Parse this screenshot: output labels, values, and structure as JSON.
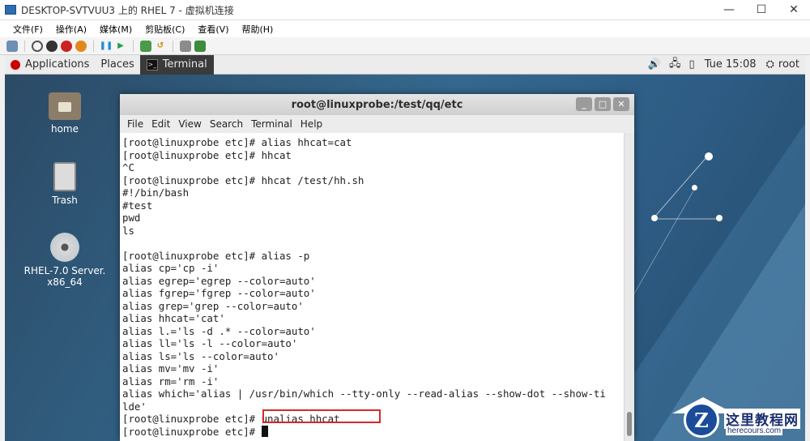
{
  "host_window": {
    "title": "DESKTOP-SVTVUU3 上的 RHEL 7 - 虚拟机连接",
    "controls": {
      "minimize": "—",
      "maximize": "☐",
      "close": "✕"
    },
    "menu": [
      "文件(F)",
      "操作(A)",
      "媒体(M)",
      "剪贴板(C)",
      "查看(V)",
      "帮助(H)"
    ],
    "toolbar_icons": [
      "ctrl-alt-del-icon",
      "start-icon",
      "turn-off-icon",
      "shutdown-icon",
      "save-icon",
      "pause-icon",
      "resume-icon",
      "checkpoint-icon",
      "revert-icon",
      "enhanced-session-icon",
      "share-icon"
    ]
  },
  "gnome_panel": {
    "applications": "Applications",
    "places": "Places",
    "task_label": "Terminal",
    "clock": "Tue 15:08",
    "user": "root"
  },
  "desktop": {
    "icons": [
      {
        "label": "home"
      },
      {
        "label": "Trash"
      },
      {
        "label_line1": "RHEL-7.0 Server.",
        "label_line2": "x86_64"
      }
    ]
  },
  "terminal": {
    "title": "root@linuxprobe:/test/qq/etc",
    "menu": [
      "File",
      "Edit",
      "View",
      "Search",
      "Terminal",
      "Help"
    ],
    "lines": [
      "[root@linuxprobe etc]# alias hhcat=cat",
      "[root@linuxprobe etc]# hhcat",
      "^C",
      "[root@linuxprobe etc]# hhcat /test/hh.sh",
      "#!/bin/bash",
      "#test",
      "pwd",
      "ls",
      "",
      "[root@linuxprobe etc]# alias -p",
      "alias cp='cp -i'",
      "alias egrep='egrep --color=auto'",
      "alias fgrep='fgrep --color=auto'",
      "alias grep='grep --color=auto'",
      "alias hhcat='cat'",
      "alias l.='ls -d .* --color=auto'",
      "alias ll='ls -l --color=auto'",
      "alias ls='ls --color=auto'",
      "alias mv='mv -i'",
      "alias rm='rm -i'",
      "alias which='alias | /usr/bin/which --tty-only --read-alias --show-dot --show-ti",
      "lde'",
      "[root@linuxprobe etc]# unalias hhcat"
    ],
    "prompt_line": "[root@linuxprobe etc]# "
  },
  "watermark": {
    "text": "这里教程网",
    "url": "herecours.com",
    "badge": "Z"
  }
}
